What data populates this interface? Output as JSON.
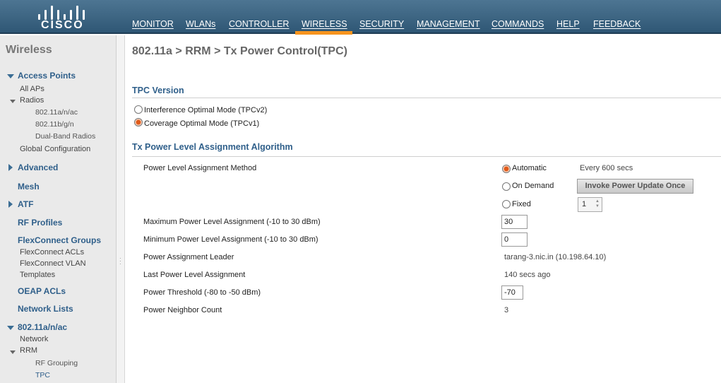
{
  "brand": {
    "logo_text": "CISCO"
  },
  "nav": {
    "items": [
      "MONITOR",
      "WLANs",
      "CONTROLLER",
      "WIRELESS",
      "SECURITY",
      "MANAGEMENT",
      "COMMANDS",
      "HELP",
      "FEEDBACK"
    ],
    "active": "WIRELESS"
  },
  "sidebar": {
    "title": "Wireless",
    "access_points": "Access Points",
    "all_aps": "All APs",
    "radios": "Radios",
    "radio_a": "802.11a/n/ac",
    "radio_b": "802.11b/g/n",
    "dual_band": "Dual-Band Radios",
    "global_config": "Global Configuration",
    "advanced": "Advanced",
    "mesh": "Mesh",
    "atf": "ATF",
    "rf_profiles": "RF Profiles",
    "flexconnect_groups": "FlexConnect Groups",
    "flexconnect_acls": "FlexConnect ACLs",
    "flexconnect_vlan": "FlexConnect VLAN",
    "templates": "Templates",
    "oeap_acls": "OEAP ACLs",
    "network_lists": "Network Lists",
    "band_80211a": "802.11a/n/ac",
    "network": "Network",
    "rrm": "RRM",
    "rf_grouping": "RF Grouping",
    "tpc": "TPC"
  },
  "main": {
    "title": "802.11a > RRM > Tx Power Control(TPC)",
    "tpc_version": {
      "heading": "TPC Version",
      "opt1": "Interference Optimal Mode (TPCv2)",
      "opt2": "Coverage Optimal Mode (TPCv1)",
      "selected": "Coverage Optimal Mode (TPCv1)"
    },
    "algo": {
      "heading": "Tx Power Level Assignment Algorithm",
      "method_label": "Power Level Assignment Method",
      "automatic": "Automatic",
      "every": "Every 600 secs",
      "on_demand": "On Demand",
      "invoke_button": "Invoke Power Update Once",
      "fixed": "Fixed",
      "fixed_value": "1",
      "selected_method": "Automatic",
      "max_label": "Maximum Power Level Assignment (-10 to 30 dBm)",
      "max_value": "30",
      "min_label": "Minimum Power Level Assignment (-10 to 30 dBm)",
      "min_value": "0",
      "leader_label": "Power Assignment Leader",
      "leader_value": "tarang-3.nic.in (10.198.64.10)",
      "last_label": "Last Power Level Assignment",
      "last_value": "140 secs ago",
      "threshold_label": "Power Threshold (-80 to -50 dBm)",
      "threshold_value": "-70",
      "neighbor_label": "Power Neighbor Count",
      "neighbor_value": "3"
    }
  },
  "colors": {
    "accent": "#f7941d",
    "header": "#3a6381",
    "link": "#2f5f8a"
  }
}
